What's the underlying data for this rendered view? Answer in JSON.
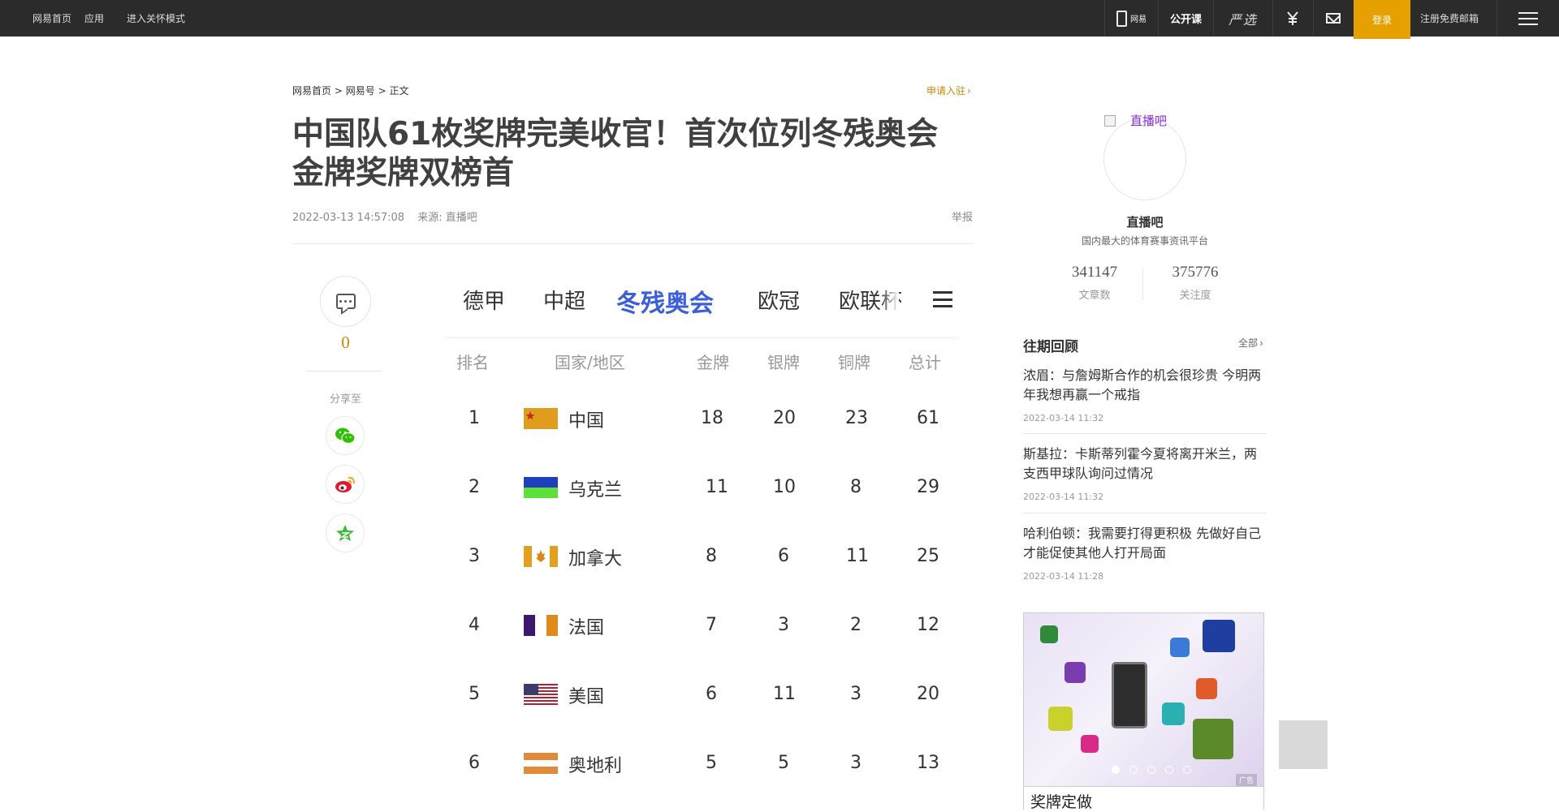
{
  "topbar": {
    "home": "网易首页",
    "apps": "应用",
    "care_mode": "进入关怀模式",
    "app_label": "网易",
    "open_course": "公开课",
    "yanxuan": "严选",
    "login": "登录",
    "register_mail": "注册免费邮箱"
  },
  "breadcrumb": {
    "home": "网易首页",
    "sep": ">",
    "wangyihao": "网易号",
    "current": "正文"
  },
  "apply_entry": "申请入驻",
  "article": {
    "title": "中国队61枚奖牌完美收官！首次位列冬残奥会金牌奖牌双榜首",
    "datetime": "2022-03-13 14:57:08",
    "source": "来源: 直播吧",
    "report": "举报"
  },
  "share": {
    "comment_count": "0",
    "share_to": "分享至"
  },
  "medal_table": {
    "tabs": [
      "德甲",
      "中超",
      "冬残奥会",
      "欧冠",
      "欧联杯"
    ],
    "active_tab": 2,
    "headers": [
      "排名",
      "国家/地区",
      "金牌",
      "银牌",
      "铜牌",
      "总计"
    ],
    "rows": [
      {
        "rank": "1",
        "country": "中国",
        "gold": "18",
        "silver": "20",
        "bronze": "23",
        "total": "61",
        "flag": "china-flag-icon"
      },
      {
        "rank": "2",
        "country": "乌克兰",
        "gold": "11",
        "silver": "10",
        "bronze": "8",
        "total": "29",
        "flag": "ukraine-flag-icon"
      },
      {
        "rank": "3",
        "country": "加拿大",
        "gold": "8",
        "silver": "6",
        "bronze": "11",
        "total": "25",
        "flag": "canada-flag-icon"
      },
      {
        "rank": "4",
        "country": "法国",
        "gold": "7",
        "silver": "3",
        "bronze": "2",
        "total": "12",
        "flag": "france-flag-icon"
      },
      {
        "rank": "5",
        "country": "美国",
        "gold": "6",
        "silver": "11",
        "bronze": "3",
        "total": "20",
        "flag": "usa-flag-icon"
      },
      {
        "rank": "6",
        "country": "奥地利",
        "gold": "5",
        "silver": "5",
        "bronze": "3",
        "total": "13",
        "flag": "austria-flag-icon"
      }
    ]
  },
  "author": {
    "avatar_alt": "直播吧",
    "name": "直播吧",
    "desc": "国内最大的体育赛事资讯平台",
    "articles": "341147",
    "articles_label": "文章数",
    "followers": "375776",
    "followers_label": "关注度"
  },
  "review": {
    "title": "往期回顾",
    "all": "全部",
    "items": [
      {
        "headline": "浓眉：与詹姆斯合作的机会很珍贵 今明两年我想再赢一个戒指",
        "time": "2022-03-14 11:32"
      },
      {
        "headline": "斯基拉：卡斯蒂列霍今夏将离开米兰，两支西甲球队询问过情况",
        "time": "2022-03-14 11:32"
      },
      {
        "headline": "哈利伯顿：我需要打得更积极 先做好自己才能促使其他人打开局面",
        "time": "2022-03-14 11:28"
      }
    ]
  },
  "ad": {
    "tag": "广告",
    "caption": "奖牌定做",
    "dots": 5,
    "active_dot": 0
  },
  "colors": {
    "topbar_bg": "#2b2b2b",
    "login_bg": "#e6a100",
    "accent_gold": "#c8870a",
    "active_tab": "#3a5fd9"
  }
}
